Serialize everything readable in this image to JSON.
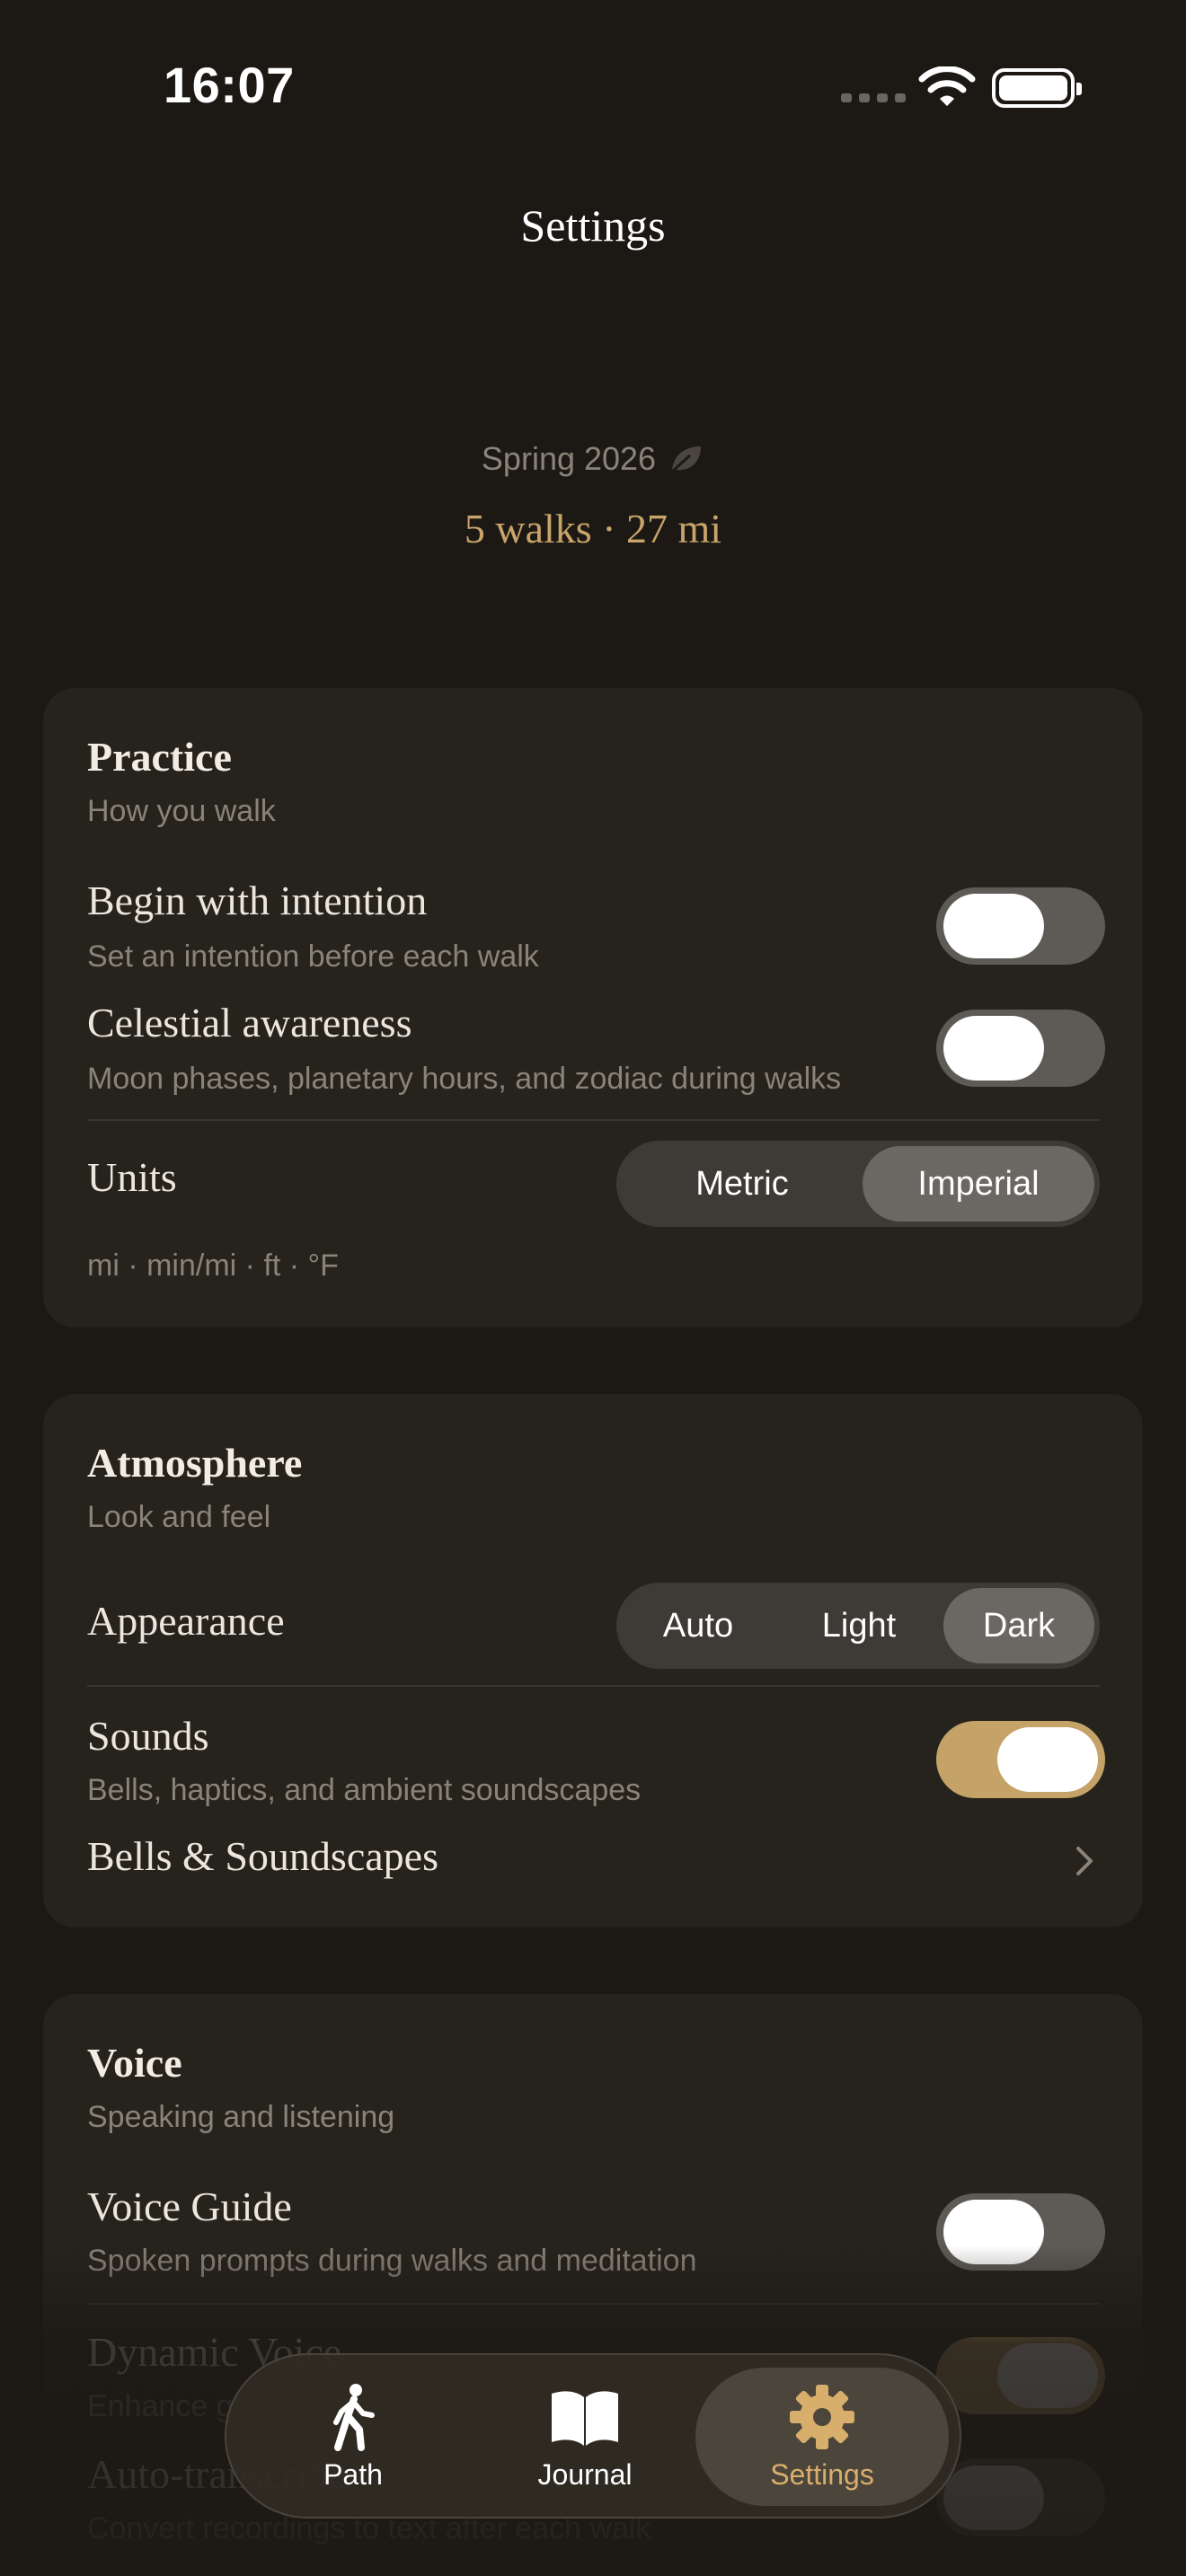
{
  "status_bar": {
    "time": "16:07"
  },
  "nav": {
    "title": "Settings"
  },
  "summary": {
    "season": "Spring 2026",
    "stats": "5 walks · 27 mi"
  },
  "practice": {
    "title": "Practice",
    "subtitle": "How you walk",
    "intention": {
      "title": "Begin with intention",
      "subtitle": "Set an intention before each walk",
      "on": false
    },
    "celestial": {
      "title": "Celestial awareness",
      "subtitle": "Moon phases, planetary hours, and zodiac during walks",
      "on": false
    },
    "units": {
      "title": "Units",
      "options": [
        "Metric",
        "Imperial"
      ],
      "selected": "Imperial",
      "detail": "mi · min/mi · ft · °F"
    }
  },
  "atmosphere": {
    "title": "Atmosphere",
    "subtitle": "Look and feel",
    "appearance": {
      "title": "Appearance",
      "options": [
        "Auto",
        "Light",
        "Dark"
      ],
      "selected": "Dark"
    },
    "sounds": {
      "title": "Sounds",
      "subtitle": "Bells, haptics, and ambient soundscapes",
      "on": true
    },
    "bells": {
      "title": "Bells & Soundscapes"
    }
  },
  "voice": {
    "title": "Voice",
    "subtitle": "Speaking and listening",
    "guide": {
      "title": "Voice Guide",
      "subtitle": "Spoken prompts during walks and meditation",
      "on": false
    },
    "dynamic": {
      "title": "Dynamic Voice",
      "subtitle": "Enhance guide voice with voice recordings",
      "on": true
    },
    "transcribe": {
      "title": "Auto-transcribe",
      "subtitle": "Convert recordings to text after each walk",
      "on": false
    }
  },
  "tab_bar": {
    "tabs": [
      {
        "label": "Path",
        "icon": "walking-figure-icon"
      },
      {
        "label": "Journal",
        "icon": "open-book-icon"
      },
      {
        "label": "Settings",
        "icon": "gear-icon"
      }
    ],
    "selected": "Settings"
  },
  "colors": {
    "accent": "#c4a268",
    "background": "#1c1915",
    "card": "#26221c"
  }
}
